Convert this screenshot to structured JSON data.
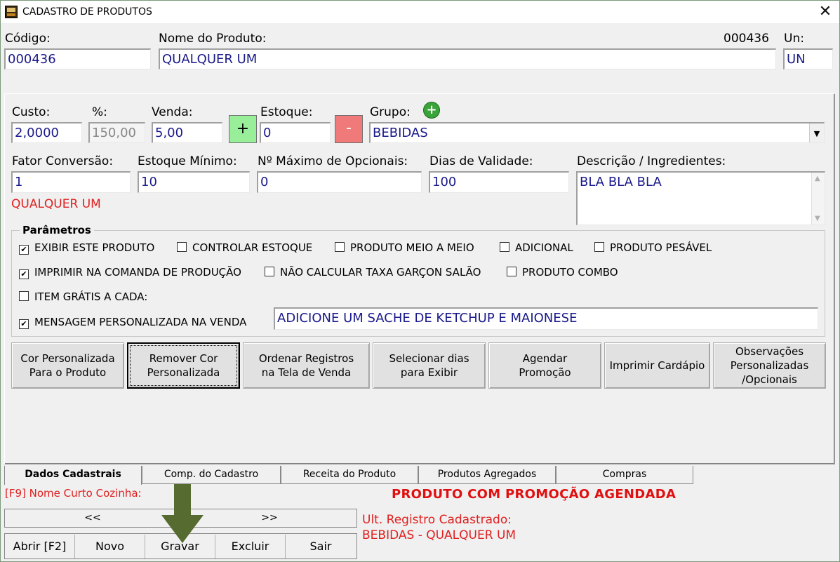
{
  "window": {
    "title": "CADASTRO DE PRODUTOS",
    "close_glyph": "✕"
  },
  "header": {
    "codigo_label": "Código:",
    "codigo_value": "000436",
    "nome_label": "Nome do Produto:",
    "nome_value": "QUALQUER UM",
    "code_display": "000436",
    "un_label": "Un:",
    "un_value": "UN"
  },
  "pricing": {
    "custo_label": "Custo:",
    "custo_value": "2,0000",
    "pct_label": "%:",
    "pct_value": "150,00",
    "venda_label": "Venda:",
    "venda_value": "5,00",
    "plus_label": "+",
    "estoque_label": "Estoque:",
    "estoque_value": "0",
    "minus_label": "-",
    "grupo_label": "Grupo:",
    "grupo_value": "BEBIDAS"
  },
  "details": {
    "fator_label": "Fator Conversão:",
    "fator_value": "1",
    "estoque_min_label": "Estoque Mínimo:",
    "estoque_min_value": "10",
    "max_opc_label": "Nº Máximo de Opcionais:",
    "max_opc_value": "0",
    "validade_label": "Dias de Validade:",
    "validade_value": "100",
    "descricao_label": "Descrição / Ingredientes:",
    "descricao_value": "BLA BLA BLA",
    "nome_red": "QUALQUER UM"
  },
  "params": {
    "title": "Parâmetros",
    "checkboxes": [
      {
        "label": "EXIBIR ESTE PRODUTO",
        "checked": true
      },
      {
        "label": "CONTROLAR ESTOQUE",
        "checked": false
      },
      {
        "label": "PRODUTO MEIO A MEIO",
        "checked": false
      },
      {
        "label": "ADICIONAL",
        "checked": false
      },
      {
        "label": "PRODUTO PESÁVEL",
        "checked": false
      },
      {
        "label": "IMPRIMIR NA COMANDA DE PRODUÇÃO",
        "checked": true
      },
      {
        "label": "NÃO CALCULAR TAXA GARÇON SALÃO",
        "checked": false
      },
      {
        "label": "PRODUTO COMBO",
        "checked": false
      },
      {
        "label": "ITEM GRÁTIS A CADA:",
        "checked": false
      },
      {
        "label": "MENSAGEM PERSONALIZADA NA VENDA",
        "checked": true
      }
    ],
    "mensagem_value": "ADICIONE UM SACHE DE KETCHUP E MAIONESE"
  },
  "actions": [
    "Cor Personalizada\nPara o Produto",
    "Remover Cor\nPersonalizada",
    "Ordenar Registros\nna Tela de Venda",
    "Selecionar dias\npara  Exibir",
    "Agendar\nPromoção",
    "Imprimir Cardápio",
    "Observações\nPersonalizadas\n/Opcionais"
  ],
  "tabs": [
    "Dados Cadastrais",
    "Comp. do Cadastro",
    "Receita do Produto",
    "Produtos Agregados",
    "Compras"
  ],
  "footer": {
    "f9_label": "[F9] Nome Curto Cozinha:",
    "promo_text": "PRODUTO COM PROMOÇÃO AGENDADA",
    "prev_label": "<<",
    "next_label": ">>",
    "ult_label": "Ult. Registro Cadastrado:",
    "ult_value": "BEBIDAS - QUALQUER UM",
    "buttons": [
      "Abrir [F2]",
      "Novo",
      "Gravar",
      "Excluir",
      "Sair"
    ]
  },
  "colors": {
    "accent_red": "#e02020",
    "field_text": "#1a1a8c",
    "plus_green": "#99ee99",
    "minus_red": "#f07a7a",
    "arrow": "#566b2f"
  }
}
